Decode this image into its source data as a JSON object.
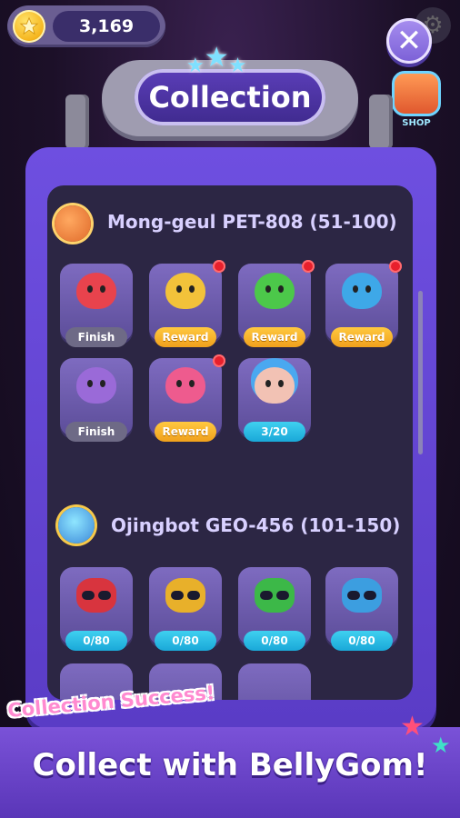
{
  "currency": {
    "amount": "3,169",
    "icon": "star-coin-icon"
  },
  "header": {
    "title": "Collection",
    "shop_label": "SHOP"
  },
  "sections": [
    {
      "title": "Mong-geul PET-808 (51-100)",
      "icon": "saturn-planet-icon",
      "items": [
        {
          "name": "red-horned-pet",
          "color": "#e8434d",
          "status": "Finish",
          "type": "finish",
          "notify": false
        },
        {
          "name": "yellow-pet",
          "color": "#f2c23a",
          "status": "Reward",
          "type": "reward",
          "notify": true
        },
        {
          "name": "green-pet",
          "color": "#4cc84a",
          "status": "Reward",
          "type": "reward",
          "notify": true
        },
        {
          "name": "blue-bear-pet",
          "color": "#3ea8e8",
          "status": "Reward",
          "type": "reward",
          "notify": true
        },
        {
          "name": "purple-pet",
          "color": "#9a6ad8",
          "status": "Finish",
          "type": "finish",
          "notify": false
        },
        {
          "name": "pink-radish-pet",
          "color": "#ee5b8e",
          "status": "Reward",
          "type": "reward",
          "notify": true
        },
        {
          "name": "blue-hair-pet",
          "color": "#f2c2b4",
          "status": "3/20",
          "type": "progress",
          "notify": false
        }
      ]
    },
    {
      "title": "Ojingbot GEO-456 (101-150)",
      "icon": "ringed-planet-icon",
      "items": [
        {
          "name": "red-robot",
          "color": "#d8343e",
          "status": "0/80",
          "type": "progress",
          "notify": false
        },
        {
          "name": "yellow-robot",
          "color": "#e8b02a",
          "status": "0/80",
          "type": "progress",
          "notify": false
        },
        {
          "name": "green-robot",
          "color": "#3cb848",
          "status": "0/80",
          "type": "progress",
          "notify": false
        },
        {
          "name": "blue-robot",
          "color": "#3c9ee0",
          "status": "0/80",
          "type": "progress",
          "notify": false
        }
      ]
    }
  ],
  "banner": {
    "tagline": "Collection Success!",
    "headline": "Collect with BellyGom!"
  }
}
